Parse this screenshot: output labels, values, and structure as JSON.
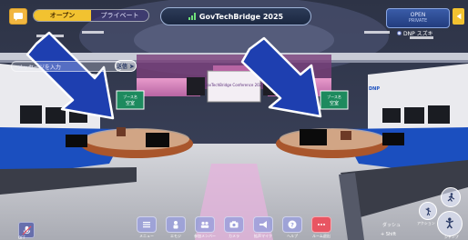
{
  "top_left": {
    "tab_open": "オープン",
    "tab_private": "プライベート"
  },
  "title_bar": {
    "title": "GovTechBridge 2025"
  },
  "status_pill": {
    "line1": "OPEN",
    "line2": "PRIVATE"
  },
  "user": {
    "name": "DNP スズキ"
  },
  "message": {
    "placeholder": "メッセージを入力",
    "send_label": "送信"
  },
  "stage": {
    "screen_text": "GovTechBridge Conference 2025",
    "booth_sign": [
      "ブース名",
      "空室"
    ],
    "dnp_sign": "DNP"
  },
  "toolbar": [
    {
      "label": "メニュー",
      "icon": "menu-icon"
    },
    {
      "label": "エモジ",
      "icon": "person-icon"
    },
    {
      "label": "参加メンバー",
      "icon": "group-icon"
    },
    {
      "label": "カメラ",
      "icon": "camera-icon"
    },
    {
      "label": "拡声マイク",
      "icon": "megaphone-icon"
    },
    {
      "label": "ヘルプ",
      "icon": "help-icon"
    },
    {
      "label": "ルーム退出",
      "icon": "exit-icon"
    }
  ],
  "mic": {
    "label": "OFF"
  },
  "controls": {
    "dash_hint": "ダッシュ",
    "shift_hint": "+ Shift",
    "action": "アクション",
    "jump": "ジャンプ",
    "run": "走る"
  },
  "colors": {
    "accent_yellow": "#f2c230",
    "floor_blue": "#1b4fbf",
    "toolbar_purple": "#9ba0dc",
    "exit_red": "#e85562"
  }
}
